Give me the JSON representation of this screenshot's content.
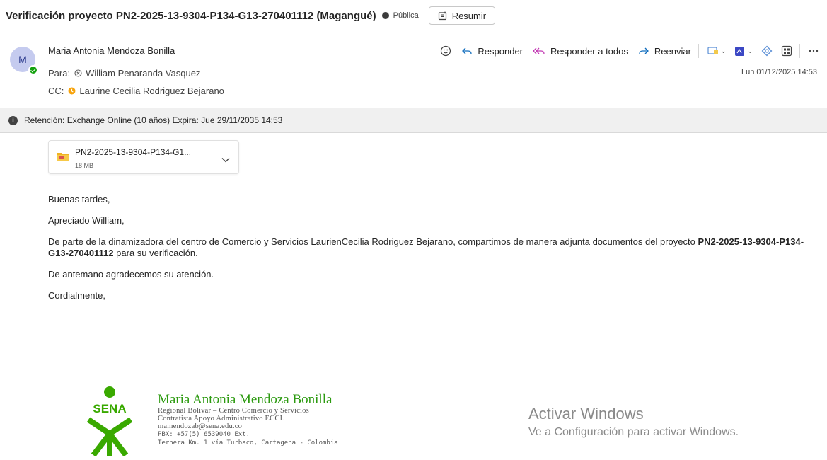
{
  "subject": {
    "title": "Verificación proyecto PN2-2025-13-9304-P134-G13-270401112 (Magangué)",
    "label": "Pública",
    "summary_button": "Resumir"
  },
  "header": {
    "avatar_initial": "M",
    "sender": "Maria Antonia Mendoza Bonilla",
    "to_label": "Para:",
    "to_name": "William Penaranda Vasquez",
    "cc_label": "CC:",
    "cc_name": "Laurine Cecilia Rodriguez Bejarano",
    "date": "Lun 01/12/2025 14:53",
    "actions": {
      "reply": "Responder",
      "reply_all": "Responder a todos",
      "forward": "Reenviar"
    }
  },
  "retention": "Retención: Exchange Online (10 años) Expira: Jue 29/11/2035 14:53",
  "attachment": {
    "name": "PN2-2025-13-9304-P134-G1...",
    "size": "18 MB"
  },
  "body": {
    "greeting": "Buenas tardes,",
    "salutation": "Apreciado William,",
    "paragraph_pre": "De parte de la dinamizadora del centro de Comercio y Servicios LaurienCecilia Rodriguez Bejarano, compartimos de manera adjunta documentos del proyecto ",
    "paragraph_bold": "PN2-2025-13-9304-P134-G13-270401112",
    "paragraph_post": "  para su verificación.",
    "thanks": "De antemano agradecemos su atención.",
    "closing": "Cordialmente,"
  },
  "signature": {
    "logo_text": "SENA",
    "name": "Maria Antonia Mendoza Bonilla",
    "line1": "Regional Bolívar – Centro Comercio y Servicios",
    "line2": "Contratista Apoyo Administrativo ECCL",
    "email": "mamendozab@sena.edu.co",
    "phone": "PBX: +57(5) 6539040 Ext.",
    "address": "Ternera Km. 1 vía Turbaco, Cartagena - Colombia"
  },
  "watermark": {
    "title": "Activar Windows",
    "subtitle": "Ve a Configuración para activar Windows."
  },
  "colors": {
    "accent": "#0f6cbd",
    "presence": "#13a10e",
    "sena_green": "#39a900",
    "cc_status": "#f7a30b"
  },
  "icons": [
    "emoji-icon",
    "reply-icon",
    "reply-all-icon",
    "forward-icon",
    "apps-icon",
    "pdf-icon",
    "loop-icon",
    "immersive-reader-icon",
    "more-icon",
    "info-icon",
    "folder-zip-icon",
    "chevron-down-icon"
  ]
}
